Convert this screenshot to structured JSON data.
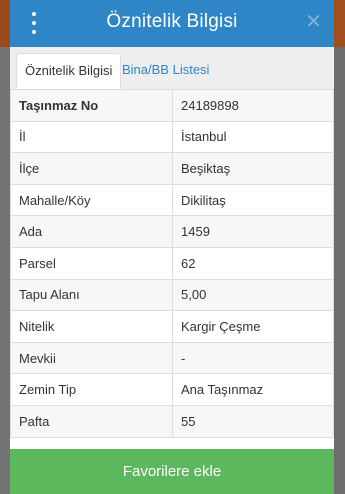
{
  "dialog": {
    "title": "Öznitelik Bilgisi",
    "close_glyph": "✕"
  },
  "tabs": [
    {
      "label": "Öznitelik Bilgisi",
      "active": true
    },
    {
      "label": "Bina/BB Listesi",
      "active": false
    }
  ],
  "attributes": [
    {
      "key": "Taşınmaz No",
      "value": "24189898"
    },
    {
      "key": "İl",
      "value": "İstanbul"
    },
    {
      "key": "İlçe",
      "value": "Beşiktaş"
    },
    {
      "key": "Mahalle/Köy",
      "value": "Dikilitaş"
    },
    {
      "key": "Ada",
      "value": "1459"
    },
    {
      "key": "Parsel",
      "value": "62"
    },
    {
      "key": "Tapu Alanı",
      "value": "5,00"
    },
    {
      "key": "Nitelik",
      "value": "Kargir Çeşme"
    },
    {
      "key": "Mevkii",
      "value": "-"
    },
    {
      "key": "Zemin Tip",
      "value": "Ana Taşınmaz"
    },
    {
      "key": "Pafta",
      "value": "55"
    }
  ],
  "footer": {
    "favorite_label": "Favorilere ekle"
  },
  "colors": {
    "header": "#2f86c6",
    "button": "#5cb85c",
    "tab_link": "#2f86c6"
  },
  "icons": {
    "menu": "kebab-menu-icon",
    "close": "close-icon"
  }
}
